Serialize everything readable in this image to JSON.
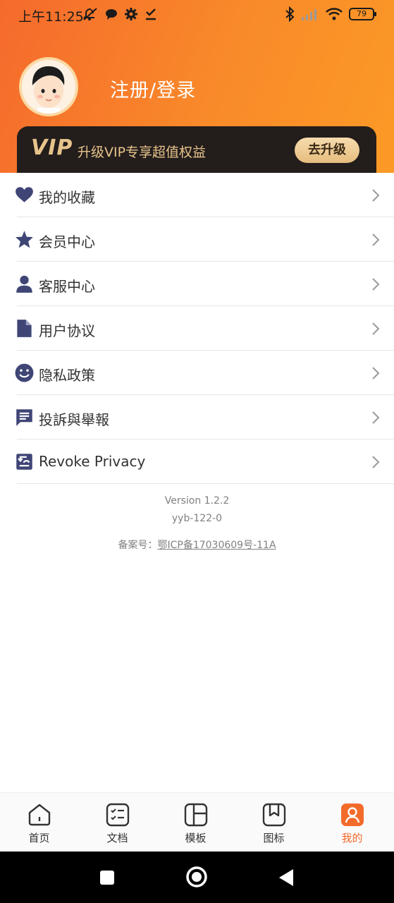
{
  "status_bar": {
    "time": "上午11:25",
    "battery": "79",
    "left_icons": [
      "mute-icon",
      "chat-bubble-icon",
      "gear-icon",
      "download-done-icon"
    ],
    "right_icons": [
      "bluetooth-icon",
      "signal-icon",
      "wifi-icon",
      "battery-icon"
    ]
  },
  "profile": {
    "login_label": "注册/登录"
  },
  "vip": {
    "logo": "VIP",
    "description": "升级VIP专享超值权益",
    "button_label": "去升级"
  },
  "menu": {
    "items": [
      {
        "label": "我的收藏",
        "icon": "heart-icon"
      },
      {
        "label": "会员中心",
        "icon": "star-icon"
      },
      {
        "label": "客服中心",
        "icon": "person-icon"
      },
      {
        "label": "用户协议",
        "icon": "document-icon"
      },
      {
        "label": "隐私政策",
        "icon": "smiley-icon"
      },
      {
        "label": "投訴與舉報",
        "icon": "feedback-icon"
      },
      {
        "label": "Revoke Privacy",
        "icon": "revoke-icon"
      }
    ]
  },
  "footer": {
    "version": "Version 1.2.2",
    "build": "yyb-122-0",
    "icp_prefix": "备案号：",
    "icp_number": "鄂ICP备17030609号-11A"
  },
  "tabbar": {
    "tabs": [
      {
        "label": "首页",
        "icon": "home-icon"
      },
      {
        "label": "文档",
        "icon": "checklist-icon"
      },
      {
        "label": "模板",
        "icon": "template-grid-icon"
      },
      {
        "label": "图标",
        "icon": "bookmark-icon"
      },
      {
        "label": "我的",
        "icon": "profile-icon",
        "active": true
      }
    ]
  },
  "colors": {
    "accent": "#f26b2b",
    "menu_icon": "#3f4676",
    "vip_gold": "#e7c48b",
    "vip_bg": "#231d1c"
  }
}
